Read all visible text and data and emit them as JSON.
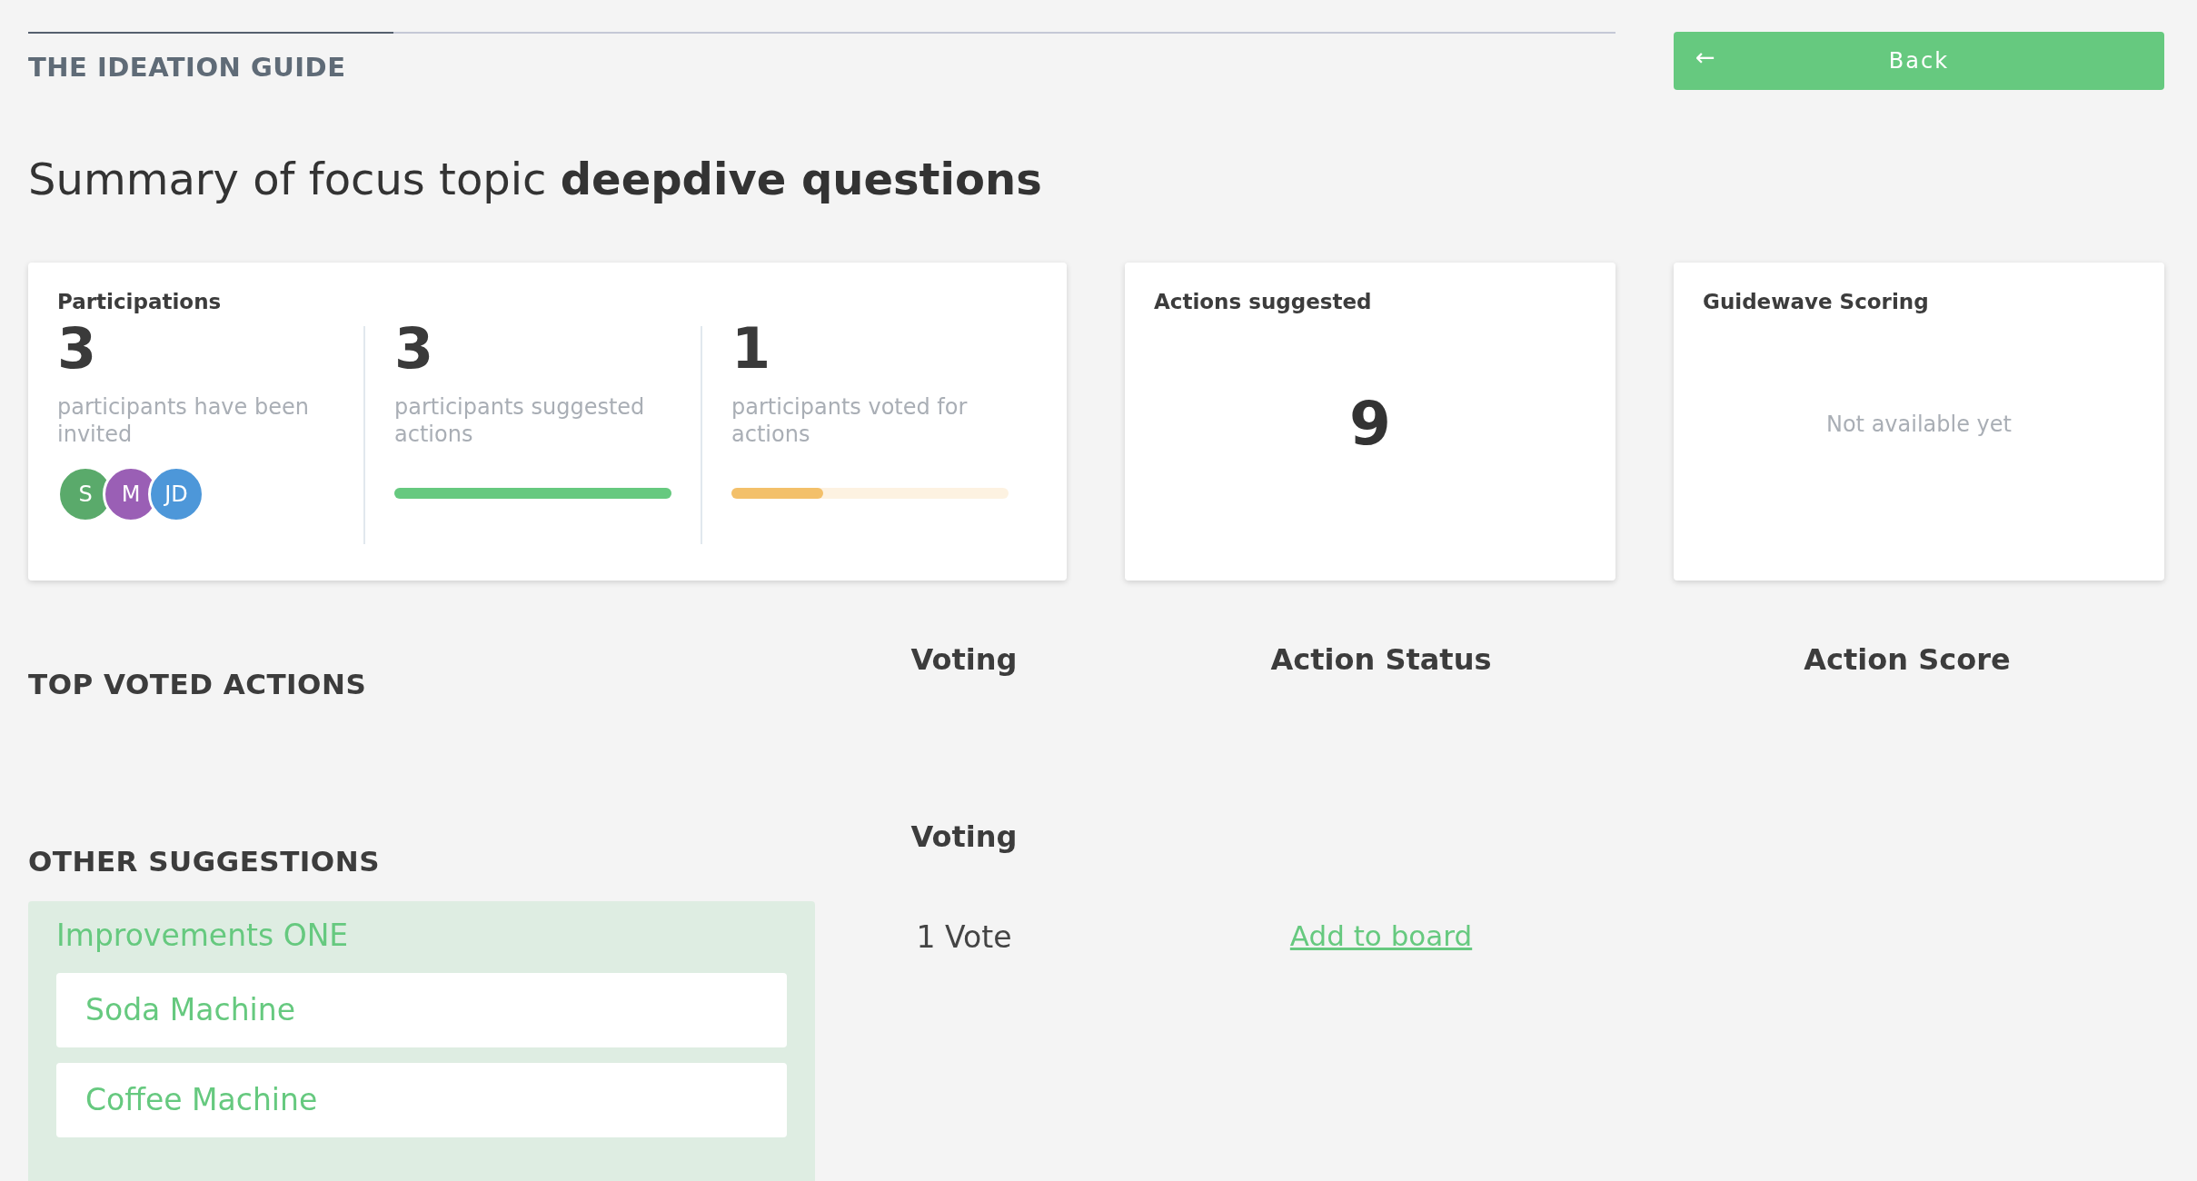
{
  "header": {
    "title": "THE IDEATION GUIDE",
    "progress": {
      "level": 0.23
    },
    "back_button": {
      "icon": "←",
      "label": "Back"
    }
  },
  "heading": "Summary of focus topic **deepdive questions**",
  "participations": {
    "title": "Participations",
    "stats": [
      {
        "kind": "avatars",
        "value": "3",
        "label": "participants have been invited",
        "avatars": [
          {
            "initials": "S",
            "color": "#5aaa6b"
          },
          {
            "initials": "M",
            "color": "#9a5fb5"
          },
          {
            "initials": "JD",
            "color": "#4d97d9"
          }
        ]
      },
      {
        "kind": "bar",
        "value": "3",
        "label": "participants suggested actions",
        "level": 1.0,
        "color": "#66c97f"
      },
      {
        "kind": "bar",
        "value": "1",
        "label": "participants voted for actions",
        "level": 0.33,
        "color": "#f3c06a"
      }
    ]
  },
  "actions_card": {
    "title": "Actions suggested",
    "value": "9"
  },
  "scoring_card": {
    "title": "Guidewave Scoring",
    "message": "Not available yet"
  },
  "top_voted": {
    "title": "TOP VOTED ACTIONS",
    "columns": [
      "Voting",
      "Action Status",
      "Action Score"
    ]
  },
  "other": {
    "title": "OTHER SUGGESTIONS",
    "columns": [
      "Voting"
    ],
    "groups": [
      {
        "title": "Improvements ONE",
        "items": [
          "Soda Machine",
          "Coffee Machine"
        ],
        "votes": "1 Vote",
        "link": "Add to board"
      }
    ]
  }
}
